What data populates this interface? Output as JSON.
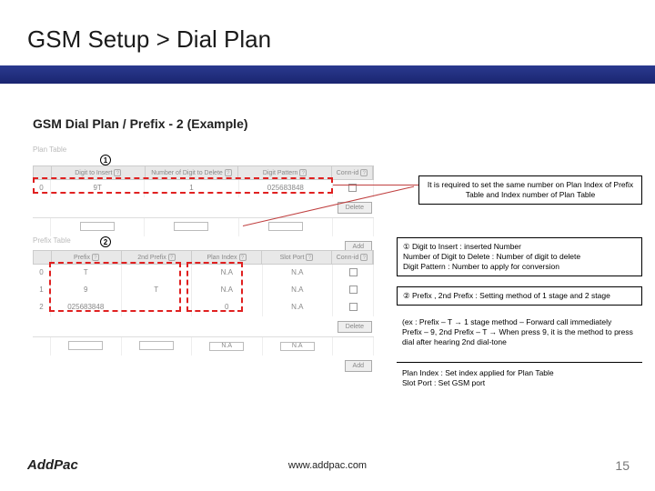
{
  "title": "GSM Setup > Dial Plan",
  "subtitle": "GSM Dial Plan / Prefix - 2 (Example)",
  "badges": {
    "one": "1",
    "two": "2"
  },
  "plan_table": {
    "caption": "Plan Table",
    "headers": [
      "Digit to Insert",
      "Number of Digit to Delete",
      "Digit Pattern",
      "Conn-id"
    ],
    "row": {
      "idx": "0",
      "insert": "9T",
      "del": "1",
      "pattern": "025683848",
      "conn": ""
    },
    "buttons": {
      "delete": "Delete",
      "add": "Add"
    }
  },
  "prefix_table": {
    "caption": "Prefix Table",
    "headers": [
      "Prefix",
      "2nd Prefix",
      "Plan Index",
      "Slot Port",
      "Conn-id"
    ],
    "rows": [
      {
        "idx": "0",
        "prefix": "T",
        "prefix2": "",
        "plan": "N.A",
        "slot": "N.A",
        "conn": ""
      },
      {
        "idx": "1",
        "prefix": "9",
        "prefix2": "T",
        "plan": "N.A",
        "slot": "N.A",
        "conn": ""
      },
      {
        "idx": "2",
        "prefix": "025683848",
        "prefix2": "",
        "plan": "0",
        "slot": "N.A",
        "conn": ""
      }
    ],
    "input_row": {
      "plan": "N.A",
      "slot": "N.A"
    },
    "buttons": {
      "delete": "Delete",
      "add": "Add"
    }
  },
  "notes": {
    "box1": "It is required to set the same number on Plan Index of Prefix Table and Index number of Plan Table",
    "box2_l1": "① Digit to Insert : inserted Number",
    "box2_l2": "Number of Digit to Delete : Number of digit to delete",
    "box2_l3": "Digit Pattern :  Number to apply for conversion",
    "box3": "② Prefix , 2nd Prefix : Setting method of 1 stage and 2 stage",
    "box4_l1": "(ex : Prefix – T → 1 stage method – Forward call immediately",
    "box4_l2": "Prefix – 9, 2nd Prefix – T → When press 9, it is the method to press dial after hearing 2nd dial-tone",
    "box5_l1": "Plan Index : Set index applied for Plan Table",
    "box5_l2": "Slot Port : Set GSM port"
  },
  "footer": {
    "logo": "AddPac",
    "url": "www.addpac.com",
    "page": "15"
  }
}
